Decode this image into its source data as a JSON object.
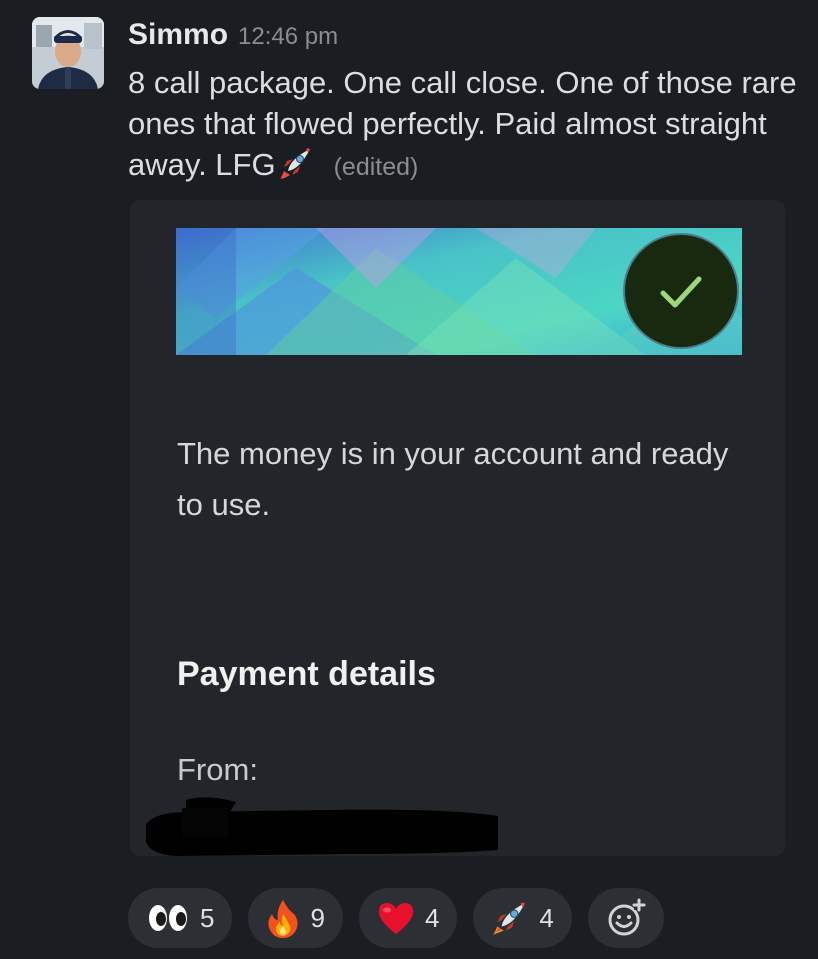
{
  "message": {
    "author": "Simmo",
    "timestamp": "12:46 pm",
    "text": "8 call package. One call close. One of those rare ones that flowed perfectly. Paid almost straight away. LFG",
    "inline_emoji": "rocket-icon",
    "edited_label": "(edited)"
  },
  "attachment": {
    "status_icon": "checkmark-icon",
    "status_color": "#19290f",
    "body_text": "The money is in your account and ready to use.",
    "heading": "Payment details",
    "from_label": "From:"
  },
  "reactions": [
    {
      "emoji": "eyes-icon",
      "count": "5"
    },
    {
      "emoji": "fire-icon",
      "count": "9"
    },
    {
      "emoji": "red-heart-icon",
      "count": "4"
    },
    {
      "emoji": "rocket-icon",
      "count": "4"
    }
  ],
  "add_reaction_icon": "add-reaction-icon"
}
